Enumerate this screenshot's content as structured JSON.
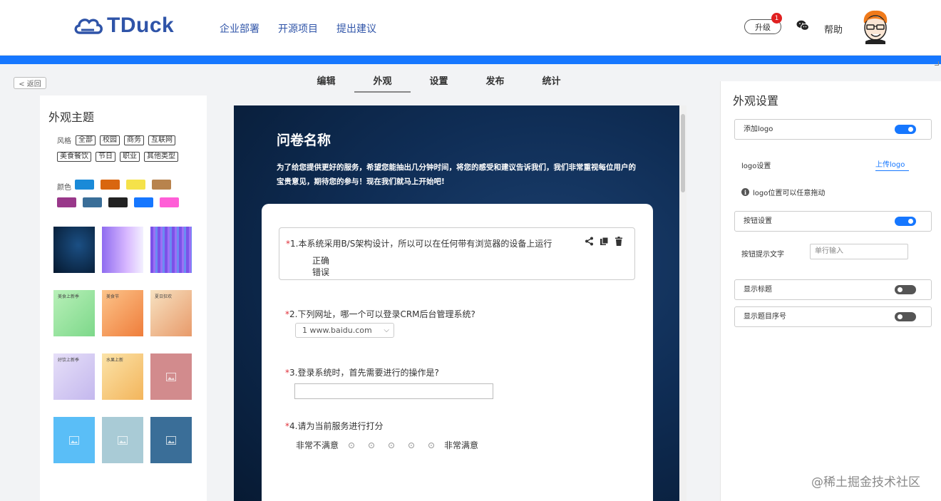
{
  "header": {
    "logo_text": "TDuck",
    "nav": [
      "企业部署",
      "开源项目",
      "提出建议"
    ],
    "upgrade_label": "升级",
    "upgrade_badge": "1",
    "help_label": "帮助"
  },
  "back_label": "< 返回",
  "tabs": [
    {
      "label": "编辑",
      "active": false
    },
    {
      "label": "外观",
      "active": true
    },
    {
      "label": "设置",
      "active": false
    },
    {
      "label": "发布",
      "active": false
    },
    {
      "label": "统计",
      "active": false
    }
  ],
  "theme_panel": {
    "title": "外观主题",
    "style_label": "风格",
    "style_tags_row1": [
      "全部",
      "校园",
      "商务",
      "互联网"
    ],
    "style_tags_row2": [
      "美食餐饮",
      "节日",
      "职业",
      "其他类型"
    ],
    "color_label": "颜色",
    "colors_row1": [
      "#1a8ad8",
      "#d9660f",
      "#f5e24a",
      "#b8834d"
    ],
    "colors_row2": [
      "#99388a",
      "#3a6e98",
      "#222222",
      "#1677ff",
      "#ff5ed7"
    ],
    "thumbnails": [
      {
        "name": "dark-blue-theme",
        "bg": "#0d2f55"
      },
      {
        "name": "purple-gradient-theme",
        "bg": "#b58cf0"
      },
      {
        "name": "violet-stripes-theme",
        "bg": "#8a5cf0"
      },
      {
        "name": "food-green-theme",
        "bg": "#9fe3a4",
        "mini": "美食上新季"
      },
      {
        "name": "food-orange-theme",
        "bg": "#f7a46a",
        "mini": "美食节"
      },
      {
        "name": "food-red-theme",
        "bg": "#f3d7b0",
        "mini": "夏日狂欢"
      },
      {
        "name": "drink-lavender-theme",
        "bg": "#d6cdf2",
        "mini": "好饮上新季"
      },
      {
        "name": "fruit-yellow-theme",
        "bg": "#f7d990",
        "mini": "水果上新"
      },
      {
        "name": "rose-placeholder-theme",
        "bg": "#d28b8d"
      },
      {
        "name": "sky-placeholder-theme",
        "bg": "#5abef7"
      },
      {
        "name": "mist-placeholder-theme",
        "bg": "#a9cbd6"
      },
      {
        "name": "steel-placeholder-theme",
        "bg": "#3a6e98"
      }
    ]
  },
  "form": {
    "title": "问卷名称",
    "description": "为了给您提供更好的服务，希望您能抽出几分钟时间，将您的感受和建议告诉我们，我们非常重视每位用户的宝贵意见，期待您的参与！现在我们就马上开始吧!",
    "q1": {
      "required": "*",
      "text": "1.本系统采用B/S架构设计，所以可以在任何带有浏览器的设备上运行",
      "options": [
        "正确",
        "错误"
      ]
    },
    "q2": {
      "required": "*",
      "text": "2.下列网址，哪一个可以登录CRM后台管理系统?",
      "select_value": "1 www.baidu.com"
    },
    "q3": {
      "required": "*",
      "text": "3.登录系统时，首先需要进行的操作是?"
    },
    "q4": {
      "required": "*",
      "text": "4.请为当前服务进行打分",
      "low_label": "非常不满意",
      "high_label": "非常满意",
      "scale_points": 5
    }
  },
  "settings": {
    "title": "外观设置",
    "add_logo_label": "添加logo",
    "add_logo_on": true,
    "logo_setting_label": "logo设置",
    "upload_logo_label": "上传logo",
    "logo_hint": "logo位置可以任意拖动",
    "button_setting_label": "按钮设置",
    "button_setting_on": true,
    "button_text_label": "按钮提示文字",
    "button_text_placeholder": "单行输入",
    "show_title_label": "显示标题",
    "show_title_on": false,
    "show_number_label": "显示题目序号",
    "show_number_on": false
  },
  "watermark": "@稀土掘金技术社区"
}
